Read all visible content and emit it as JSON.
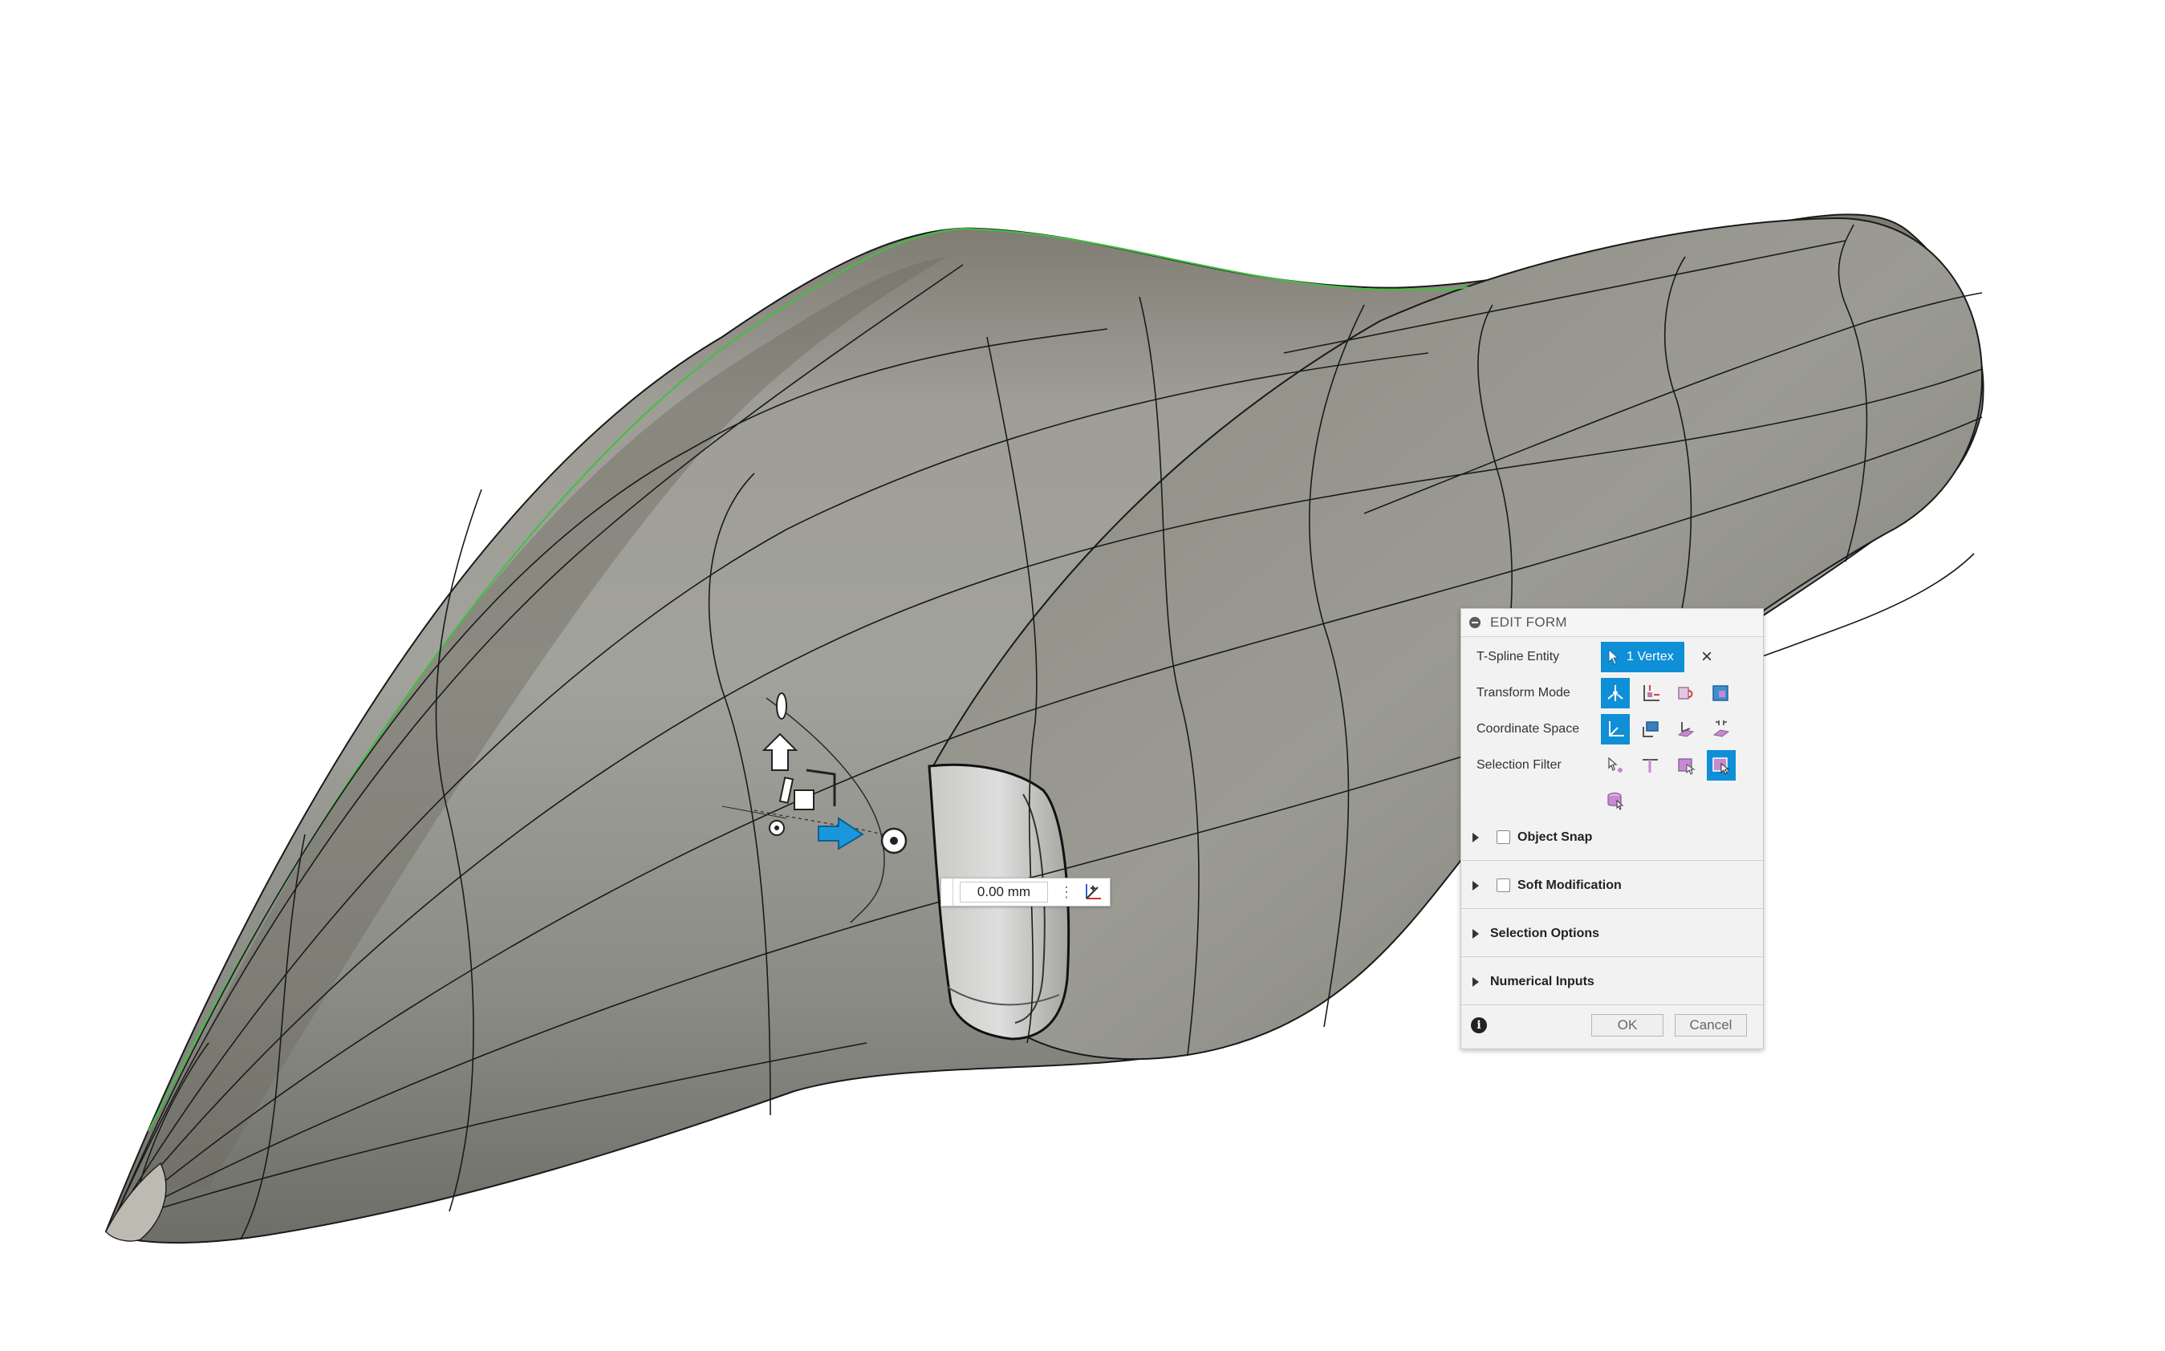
{
  "panel": {
    "title": "EDIT FORM",
    "rows": {
      "tspline_entity": "T-Spline Entity",
      "transform_mode": "Transform Mode",
      "coordinate_space": "Coordinate Space",
      "selection_filter": "Selection Filter"
    },
    "entity_chip": "1 Vertex",
    "sections": {
      "object_snap": "Object Snap",
      "soft_modification": "Soft Modification",
      "selection_options": "Selection Options",
      "numerical_inputs": "Numerical Inputs"
    },
    "ok": "OK",
    "cancel": "Cancel"
  },
  "distance": {
    "value": "0.00 mm"
  },
  "colors": {
    "accent": "#0f8fd6",
    "body_surface": "#8e8e86",
    "edge_line": "#1a1a1a",
    "highlight_edge": "#3fc23f",
    "manipulator_arrow": "#1a96dc"
  }
}
